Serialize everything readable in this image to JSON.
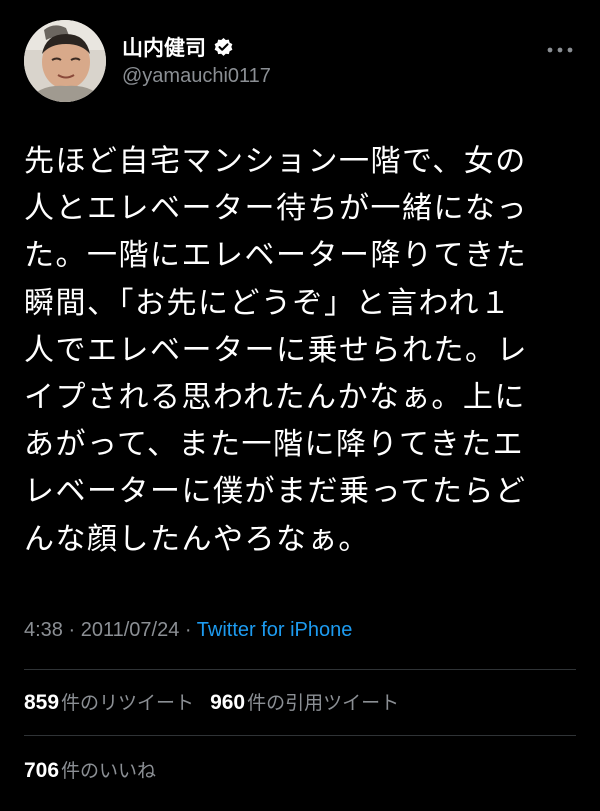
{
  "author": {
    "display_name": "山内健司",
    "handle": "@yamauchi0117",
    "verified": true,
    "avatar_icon": "avatar-photo"
  },
  "tweet": {
    "lines": [
      "先ほど自宅マンション一階で、女の",
      "人とエレベーター待ちが一緒になっ",
      "た。一階にエレベーター降りてきた",
      "瞬間、「お先にどうぞ」と言われ１",
      "人でエレベーターに乗せられた。レ",
      "イプされる思われたんかなぁ。上に",
      "あがって、また一階に降りてきたエ",
      "レベーターに僕がまだ乗ってたらど",
      "んな顔したんやろなぁ。"
    ]
  },
  "meta": {
    "time": "4:38",
    "separator": " · ",
    "date": "2011/07/24",
    "source": "Twitter for iPhone"
  },
  "stats": {
    "retweets_count": "859",
    "retweets_label": "件のリツイート",
    "quotes_count": "960",
    "quotes_label": "件の引用ツイート",
    "likes_count": "706",
    "likes_label": "件のいいね"
  },
  "colors": {
    "background": "#000000",
    "secondary_text": "#8b8f94",
    "link": "#1d9bf0",
    "divider": "#2f3336"
  }
}
